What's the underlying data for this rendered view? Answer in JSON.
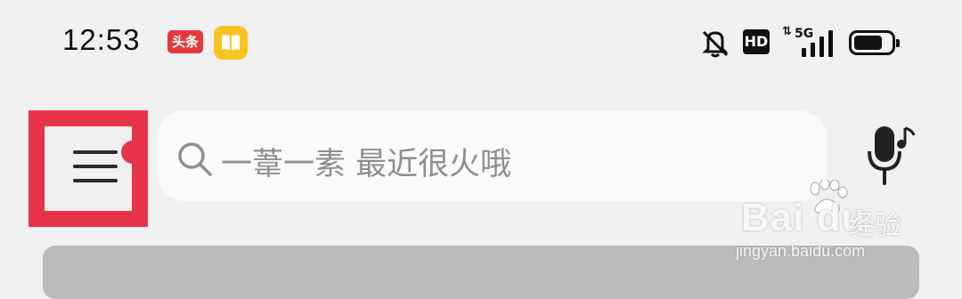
{
  "status_bar": {
    "time": "12:53",
    "toutiao_badge": "头条",
    "hd_label": "HD",
    "network_label": "5G",
    "network_arrows": "⇅",
    "icons": [
      "toutiao-app-icon",
      "book-app-icon",
      "bell-muted-icon",
      "hd-icon",
      "signal-5g-icon",
      "battery-icon"
    ]
  },
  "toolbar": {
    "menu_icon": "hamburger-menu-icon",
    "has_notification": true,
    "highlight_color": "#e8344a",
    "search": {
      "icon": "search-icon",
      "placeholder": "一葦一素 最近很火哦"
    },
    "voice_icon": "music-microphone-icon"
  },
  "watermark": {
    "brand": "Bai du",
    "sub": "经验",
    "url": "jingyan.baidu.com"
  }
}
